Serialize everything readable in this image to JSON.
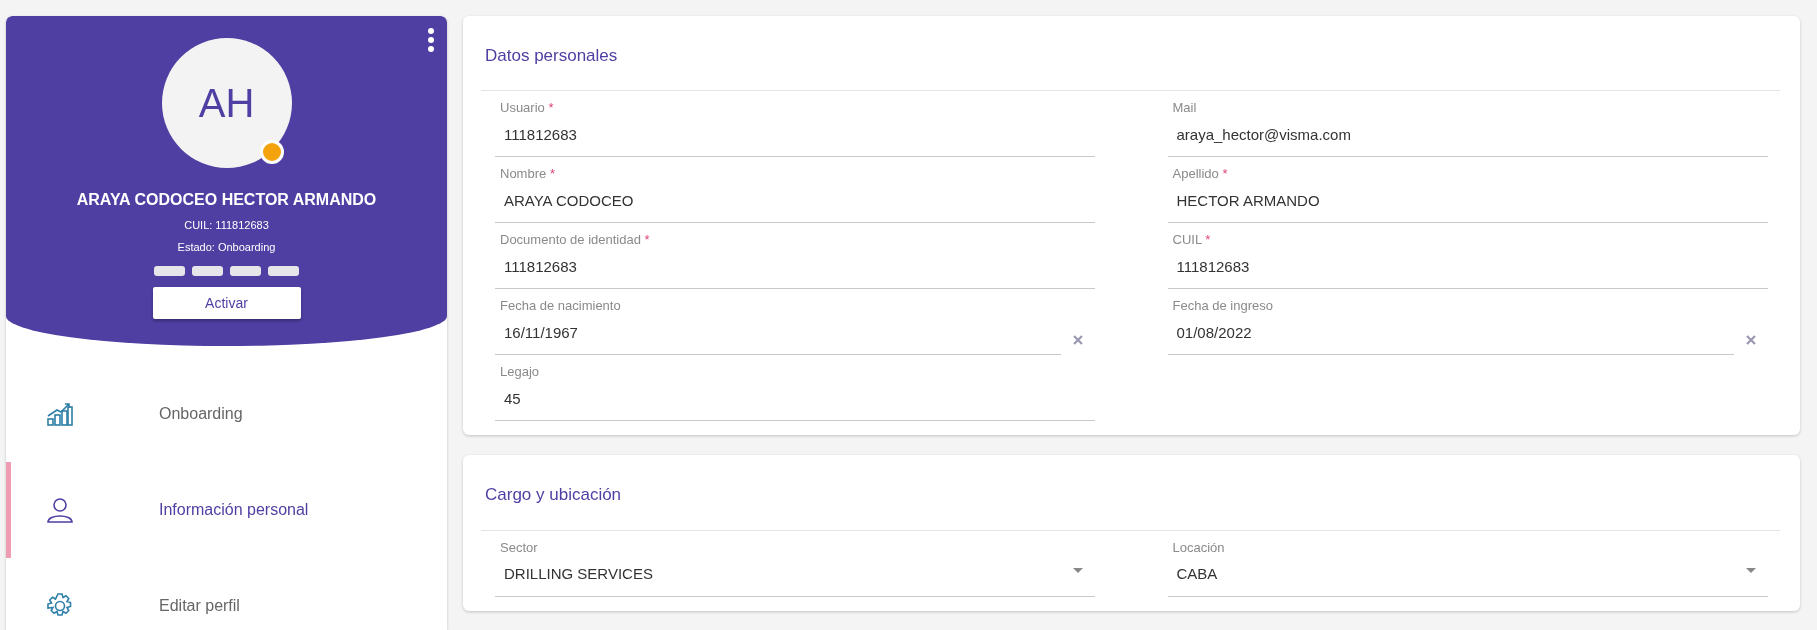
{
  "profile": {
    "initials": "AH",
    "name": "ARAYA CODOCEO HECTOR ARMANDO",
    "cuil": "CUIL: 111812683",
    "status": "Estado: Onboarding",
    "button": "Activar"
  },
  "sidebar": {
    "items": [
      {
        "label": "Onboarding",
        "selected": false
      },
      {
        "label": "Información personal",
        "selected": true
      },
      {
        "label": "Editar perfil",
        "selected": false
      }
    ]
  },
  "sections": [
    {
      "title": "Datos personales",
      "fields": [
        {
          "label": "Usuario",
          "required_mark": "*",
          "value": "111812683",
          "kind": "text"
        },
        {
          "label": "Mail",
          "value": "araya_hector@visma.com",
          "kind": "text"
        },
        {
          "label": "Nombre",
          "required_mark": "*",
          "value": "ARAYA CODOCEO",
          "kind": "text"
        },
        {
          "label": "Apellido",
          "required_mark": "*",
          "value": "HECTOR ARMANDO",
          "kind": "text"
        },
        {
          "label": "Documento de identidad",
          "required_mark": "*",
          "value": "111812683",
          "kind": "text"
        },
        {
          "label": "CUIL",
          "required_mark": "*",
          "value": "111812683",
          "kind": "text"
        },
        {
          "label": "Fecha de nacimiento",
          "value": "16/11/1967",
          "kind": "date"
        },
        {
          "label": "Fecha de ingreso",
          "value": "01/08/2022",
          "kind": "date"
        },
        {
          "label": "Legajo",
          "value": "45",
          "kind": "text"
        }
      ]
    },
    {
      "title": "Cargo y ubicación",
      "fields": [
        {
          "label": "Sector",
          "value": "DRILLING SERVICES",
          "kind": "select"
        },
        {
          "label": "Locación",
          "value": "CABA",
          "kind": "select"
        }
      ]
    }
  ]
}
